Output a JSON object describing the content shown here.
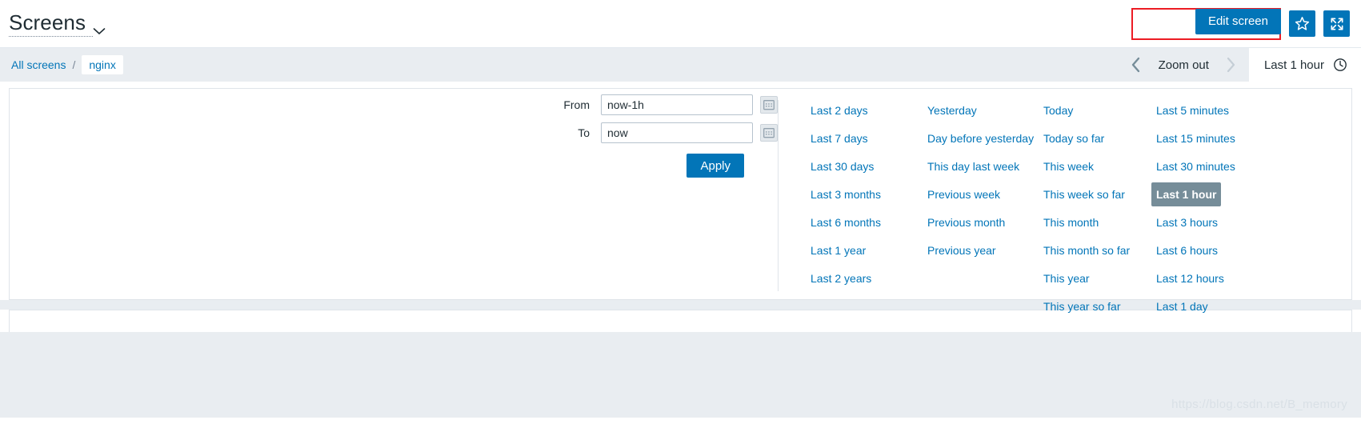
{
  "header": {
    "title": "Screens",
    "dropdown_icon": "chevron-down-icon",
    "edit_screen_label": "Edit screen",
    "favorite_icon": "star-icon",
    "fullscreen_icon": "expand-arrows-icon",
    "annotation_color": "#ec1c24",
    "accent_color": "#0275b8"
  },
  "breadcrumb": {
    "root_label": "All screens",
    "separator": "/",
    "current_label": "nginx"
  },
  "time_nav": {
    "prev_icon": "chevron-left-icon",
    "zoom_out_label": "Zoom out",
    "next_icon": "chevron-right-icon",
    "next_disabled": true,
    "selected_range_label": "Last 1 hour",
    "clock_icon": "clock-icon"
  },
  "time_panel": {
    "from_label": "From",
    "from_value": "now-1h",
    "from_placeholder": "now-1h",
    "to_label": "To",
    "to_value": "now",
    "to_placeholder": "now",
    "calendar_icon": "calendar-icon",
    "apply_label": "Apply",
    "selected_quick_range": "Last 1 hour",
    "selected_bg": "#768d99",
    "link_color": "#0275b8",
    "quick_ranges": [
      {
        "column": 1,
        "items": [
          "Last 2 days",
          "Last 7 days",
          "Last 30 days",
          "Last 3 months",
          "Last 6 months",
          "Last 1 year",
          "Last 2 years"
        ]
      },
      {
        "column": 2,
        "items": [
          "Yesterday",
          "Day before yesterday",
          "This day last week",
          "Previous week",
          "Previous month",
          "Previous year"
        ]
      },
      {
        "column": 3,
        "items": [
          "Today",
          "Today so far",
          "This week",
          "This week so far",
          "This month",
          "This month so far",
          "This year",
          "This year so far"
        ]
      },
      {
        "column": 4,
        "items": [
          "Last 5 minutes",
          "Last 15 minutes",
          "Last 30 minutes",
          "Last 1 hour",
          "Last 3 hours",
          "Last 6 hours",
          "Last 12 hours",
          "Last 1 day"
        ]
      }
    ]
  },
  "watermark": {
    "text": "https://blog.csdn.net/B_memory"
  }
}
